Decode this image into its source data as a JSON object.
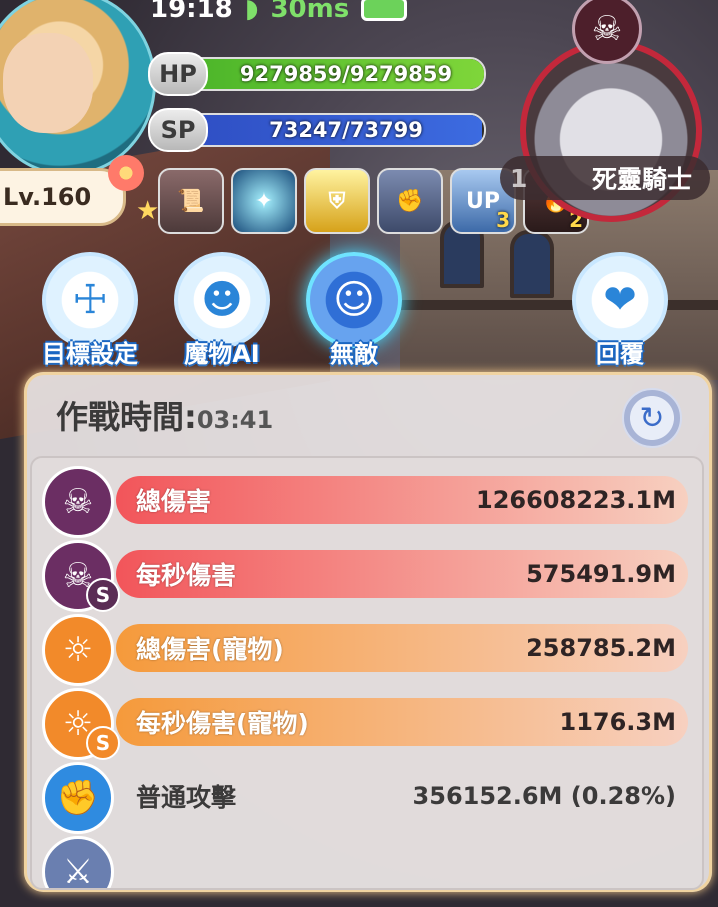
{
  "status": {
    "time": "19:18",
    "ping": "30ms",
    "wifi_icon": "wifi-icon",
    "battery_icon": "battery-icon"
  },
  "player": {
    "level": "Lv.160",
    "hp": {
      "label": "HP",
      "text": "9279859/9279859",
      "current": 9279859,
      "max": 9279859,
      "color": "#7fd63a"
    },
    "sp": {
      "label": "SP",
      "text": "73247/73799",
      "current": 73247,
      "max": 73799,
      "color": "#3c6be0"
    }
  },
  "buffs": [
    {
      "icon": "scroll-icon",
      "count": ""
    },
    {
      "icon": "aura-figure-icon",
      "count": ""
    },
    {
      "icon": "shield-up-icon",
      "count": ""
    },
    {
      "icon": "fist-icon",
      "count": ""
    },
    {
      "icon": "helmet-up-icon",
      "label": "UP",
      "count": "3"
    },
    {
      "icon": "flame-icon",
      "count": "2"
    }
  ],
  "boss": {
    "name": "死靈騎士",
    "level_partial": "1"
  },
  "actions": [
    {
      "label": "目標設定",
      "icon": "scarecrow-icon",
      "active": false
    },
    {
      "label": "魔物AI",
      "icon": "monster-face-icon",
      "active": false
    },
    {
      "label": "無敵",
      "icon": "invincible-figure-icon",
      "active": true
    },
    {
      "label": "回覆",
      "icon": "heart-plus-icon",
      "active": false
    }
  ],
  "battle_panel": {
    "title": "作戰時間:",
    "time": "03:41",
    "refresh_icon": "refresh-icon",
    "rows": [
      {
        "label": "總傷害",
        "value": "126608223.1M",
        "icon": "skull-icon",
        "badge": "",
        "color": "#f2555a"
      },
      {
        "label": "每秒傷害",
        "value": "575491.9M",
        "icon": "skull-icon",
        "badge": "S",
        "color": "#f2555a"
      },
      {
        "label": "總傷害(寵物)",
        "value": "258785.2M",
        "icon": "pet-face-icon",
        "badge": "",
        "color": "#f59a3b"
      },
      {
        "label": "每秒傷害(寵物)",
        "value": "1176.3M",
        "icon": "pet-face-icon",
        "badge": "S",
        "color": "#f59a3b"
      },
      {
        "label": "普通攻擊",
        "value": "356152.6M (0.28%)",
        "icon": "fist-icon",
        "badge": "",
        "color": ""
      }
    ]
  },
  "colors": {
    "accent_blue": "#1a66c2",
    "damage_red": "#f2555a",
    "pet_orange": "#f59a3b",
    "panel_glow": "#f3c98a"
  }
}
